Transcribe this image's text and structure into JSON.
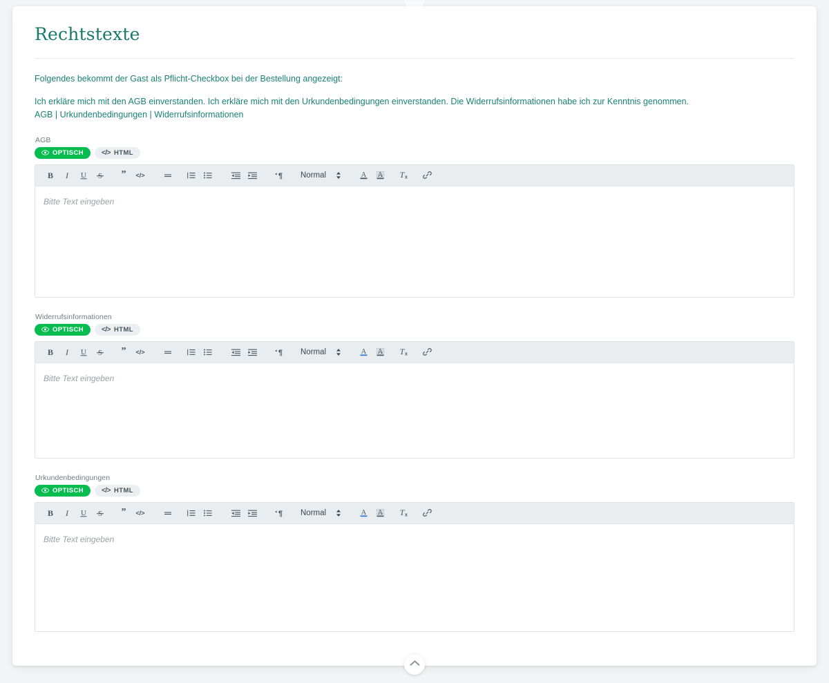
{
  "page": {
    "title": "Rechtstexte",
    "intro": "Folgendes bekommt der Gast als Pflicht-Checkbox bei der Bestellung angezeigt:",
    "clause": "Ich erkläre mich mit den AGB einverstanden. Ich erkläre mich mit den Urkundenbedingungen einverstanden. Die Widerrufsinformationen habe ich zur Kenntnis genommen.",
    "clause_links": "AGB | Urkundenbedingungen | Widerrufsinformationen",
    "accent_color": "#17796c",
    "text_color": "#1b8276",
    "toggle_active_color": "#05bd4e",
    "toolbar_bg": "#e9edef"
  },
  "toggle": {
    "visual_label": "OPTISCH",
    "visual_icon": "eye-icon",
    "html_label": "HTML",
    "html_icon": "code-icon"
  },
  "toolbar": {
    "bold": "B",
    "italic": "I",
    "underline": "U",
    "strike": "S",
    "blockquote_icon": "blockquote-icon",
    "code_icon": "code-block-icon",
    "align_icon": "align-icon",
    "ordered_list_icon": "ordered-list-icon",
    "bullet_list_icon": "bullet-list-icon",
    "outdent_icon": "outdent-icon",
    "indent_icon": "indent-icon",
    "direction_icon": "text-direction-icon",
    "format_value": "Normal",
    "format_caret_icon": "updown-caret-icon",
    "text_color_icon": "text-color-icon",
    "background_color_icon": "background-color-icon",
    "clear_format_icon": "clear-format-icon",
    "link_icon": "link-icon"
  },
  "editors": [
    {
      "label": "AGB",
      "placeholder": "Bitte Text eingeben",
      "value": ""
    },
    {
      "label": "Widerrufsinformationen",
      "placeholder": "Bitte Text eingeben",
      "value": ""
    },
    {
      "label": "Urkundenbedingungen",
      "placeholder": "Bitte Text eingeben",
      "value": ""
    }
  ],
  "scroll_top": {
    "icon": "chevron-up-icon"
  }
}
